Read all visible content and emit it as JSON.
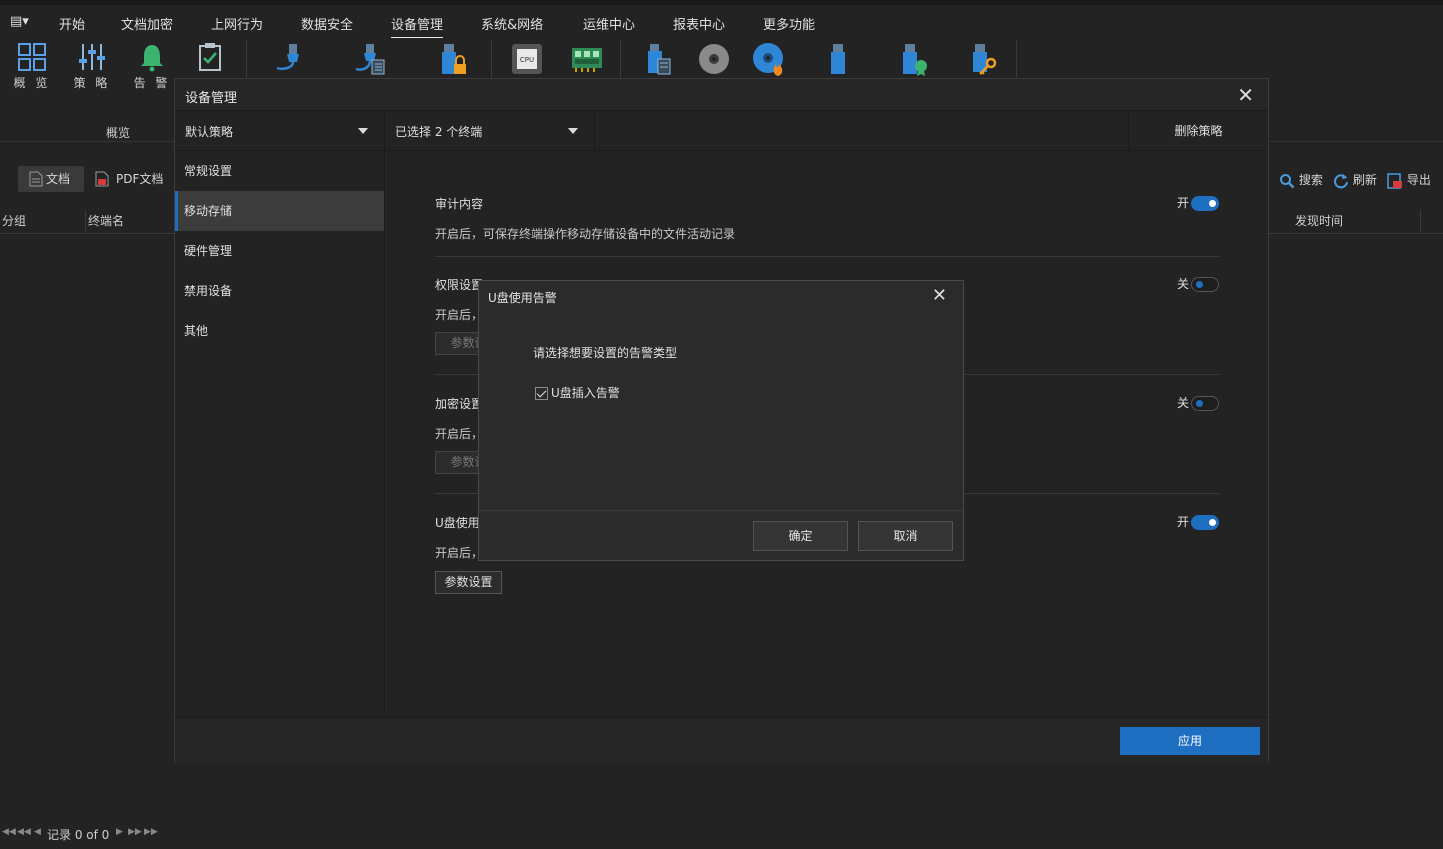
{
  "menubar": {
    "items": [
      {
        "label": "开始"
      },
      {
        "label": "文档加密"
      },
      {
        "label": "上网行为"
      },
      {
        "label": "数据安全"
      },
      {
        "label": "设备管理"
      },
      {
        "label": "系统&网络"
      },
      {
        "label": "运维中心"
      },
      {
        "label": "报表中心"
      },
      {
        "label": "更多功能"
      }
    ],
    "active_index": 4
  },
  "ribbon": {
    "overview_label": "概 览",
    "policy_label": "策 略",
    "alert_label": "告 警",
    "group_label": "概览"
  },
  "background": {
    "doc_tab": "文档",
    "pdf_tab": "PDF文档",
    "search": "搜索",
    "refresh": "刷新",
    "export": "导出",
    "col_group": "分组",
    "col_terminal": "终端名",
    "col_found_time": "发现时间",
    "record": "记录 0 of 0"
  },
  "device_dialog": {
    "title": "设备管理",
    "policy": "默认策略",
    "terminals": "已选择 2 个终端",
    "delete_policy": "删除策略",
    "nav": [
      "常规设置",
      "移动存储",
      "硬件管理",
      "禁用设备",
      "其他"
    ],
    "active_nav": 1,
    "sections": {
      "audit": {
        "title": "审计内容",
        "desc": "开启后，可保存终端操作移动存储设备中的文件活动记录",
        "state": "开"
      },
      "permission": {
        "title": "权限设置",
        "desc": "开启后，",
        "state": "关",
        "btn": "参数设"
      },
      "encrypt": {
        "title": "加密设置",
        "desc": "开启后，",
        "state": "关",
        "btn": "参数设"
      },
      "usb": {
        "title": "U盘使用",
        "desc": "开启后，",
        "state": "开",
        "btn": "参数设置"
      }
    },
    "apply": "应用"
  },
  "usb_dialog": {
    "title": "U盘使用告警",
    "prompt": "请选择想要设置的告警类型",
    "option": "U盘插入告警",
    "ok": "确定",
    "cancel": "取消"
  },
  "colors": {
    "accent": "#1e6fc1",
    "background": "#232323"
  }
}
